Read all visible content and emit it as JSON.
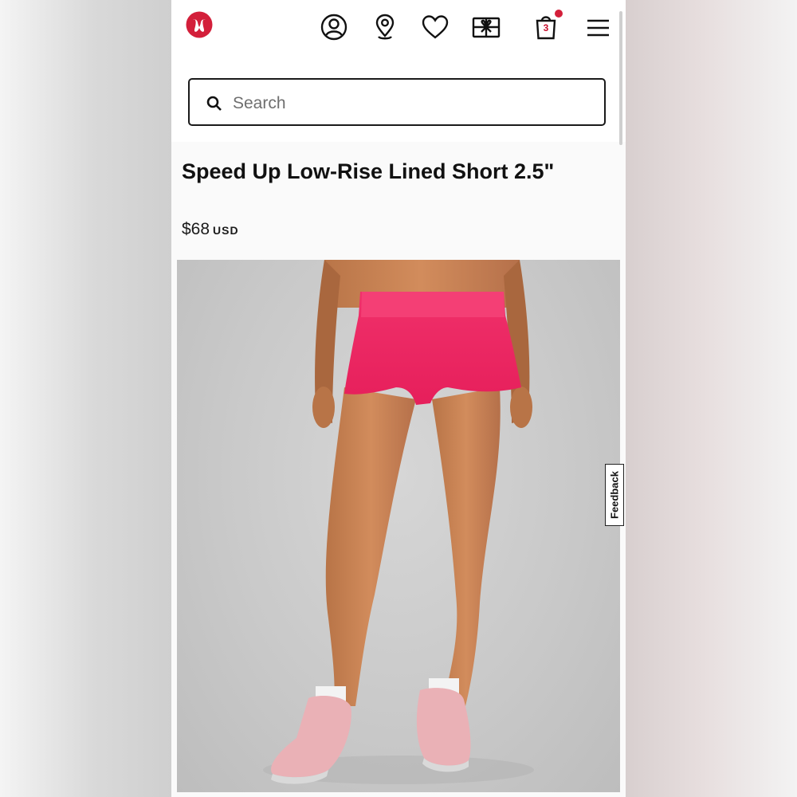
{
  "header": {
    "logo": "lululemon-logo",
    "icons": [
      "account-icon",
      "store-locator-icon",
      "wishlist-heart-icon",
      "gift-card-icon",
      "shopping-bag-icon",
      "menu-icon"
    ],
    "cart_count": "3",
    "brand_color": "#d31f3a"
  },
  "search": {
    "placeholder": "Search"
  },
  "product": {
    "title": "Speed Up Low-Rise Lined Short 2.5\"",
    "price": "$68",
    "currency": "USD",
    "image": "product-photo"
  },
  "feedback": {
    "label": "Feedback"
  }
}
